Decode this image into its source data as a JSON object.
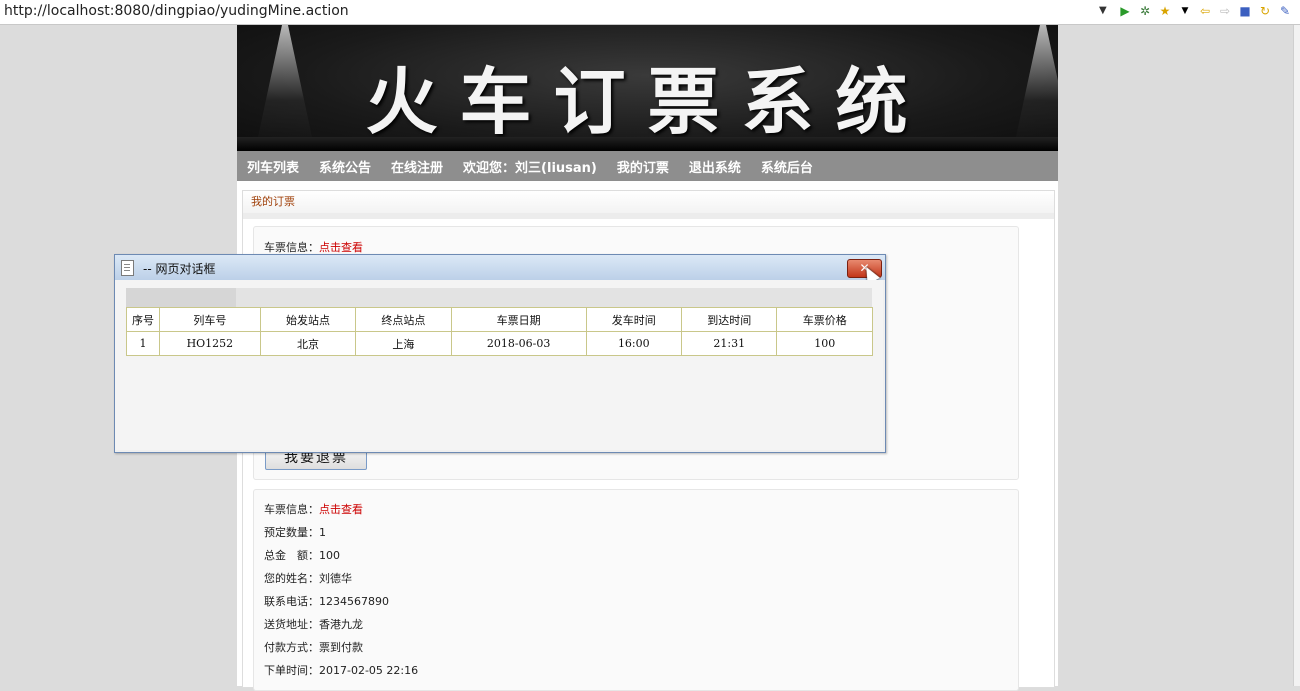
{
  "browser": {
    "url": "http://localhost:8080/dingpiao/yudingMine.action"
  },
  "banner": {
    "title": "火车订票系统"
  },
  "nav": {
    "items": [
      "列车列表",
      "系统公告",
      "在线注册",
      "欢迎您：刘三(liusan)",
      "我的订票",
      "退出系统",
      "系统后台"
    ]
  },
  "section_title": "我的订票",
  "order1": {
    "ticket_label": "车票信息：",
    "ticket_link": "点击查看",
    "refund_button": "我要退票"
  },
  "order2": {
    "ticket_label": "车票信息：",
    "ticket_link": "点击查看",
    "quantity": "预定数量：1",
    "total": "总金　额：100",
    "name": "您的姓名：刘德华",
    "phone": "联系电话：1234567890",
    "address": "送货地址：香港九龙",
    "payment": "付款方式：票到付款",
    "order_time": "下单时间：2017-02-05 22:16"
  },
  "dialog": {
    "title": "-- 网页对话框",
    "close_label": "✕",
    "columns": [
      "序号",
      "列车号",
      "始发站点",
      "终点站点",
      "车票日期",
      "发车时间",
      "到达时间",
      "车票价格"
    ],
    "rows": [
      [
        "1",
        "HO1252",
        "北京",
        "上海",
        "2018-06-03",
        "16:00",
        "21:31",
        "100"
      ]
    ]
  }
}
